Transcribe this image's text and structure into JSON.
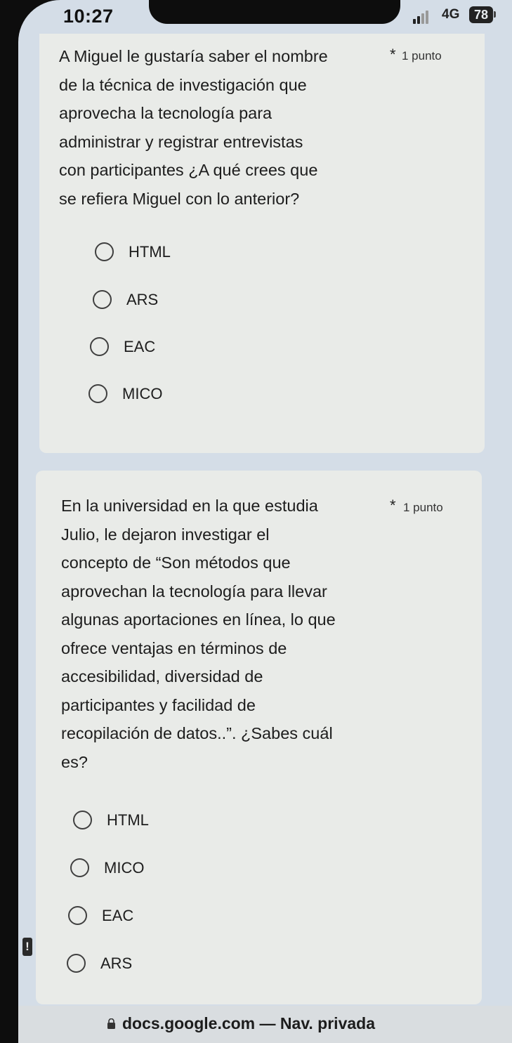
{
  "status_bar": {
    "time": "10:27",
    "network": "4G",
    "battery": "78"
  },
  "questions": [
    {
      "text": "A Miguel le gustaría saber el nombre\nde la técnica de investigación que\naprovecha la tecnología para\nadministrar y registrar entrevistas\ncon participantes ¿A qué crees que\nse refiera Miguel con lo anterior?",
      "required": "*",
      "points": "1 punto",
      "options": [
        "HTML",
        "ARS",
        "EAC",
        "MICO"
      ]
    },
    {
      "text": "En la universidad en la que estudia\nJulio, le dejaron investigar el\nconcepto de “Son métodos que\naprovechan la tecnología para llevar\nalgunas aportaciones en línea, lo que\nofrece ventajas en términos de\naccesibilidad, diversidad de\nparticipantes y facilidad de\nrecopilación de datos..”. ¿Sabes cuál\nes?",
      "required": "*",
      "points": "1 punto",
      "options": [
        "HTML",
        "MICO",
        "EAC",
        "ARS"
      ]
    }
  ],
  "alert": {
    "glyph": "!"
  },
  "address_bar": {
    "text": "docs.google.com — Nav. privada"
  },
  "colors": {
    "page_background": "#d4dde7",
    "card_background": "#e9ebe8",
    "text": "#1d1d1d"
  },
  "icons": [
    "signal-bars-icon",
    "battery-icon",
    "lock-icon",
    "alert-icon"
  ]
}
